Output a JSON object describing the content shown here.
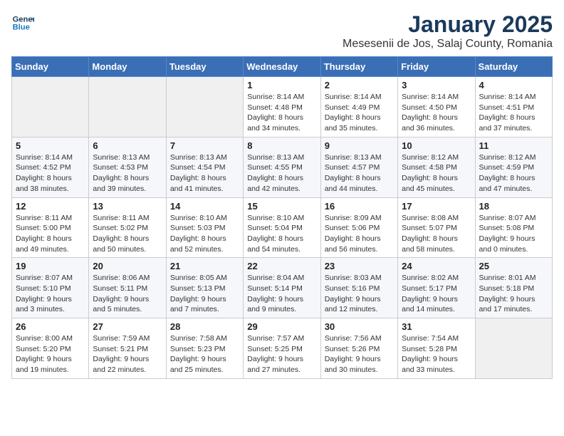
{
  "header": {
    "logo_line1": "General",
    "logo_line2": "Blue",
    "month": "January 2025",
    "location": "Mesesenii de Jos, Salaj County, Romania"
  },
  "weekdays": [
    "Sunday",
    "Monday",
    "Tuesday",
    "Wednesday",
    "Thursday",
    "Friday",
    "Saturday"
  ],
  "weeks": [
    [
      {
        "day": "",
        "info": ""
      },
      {
        "day": "",
        "info": ""
      },
      {
        "day": "",
        "info": ""
      },
      {
        "day": "1",
        "info": "Sunrise: 8:14 AM\nSunset: 4:48 PM\nDaylight: 8 hours\nand 34 minutes."
      },
      {
        "day": "2",
        "info": "Sunrise: 8:14 AM\nSunset: 4:49 PM\nDaylight: 8 hours\nand 35 minutes."
      },
      {
        "day": "3",
        "info": "Sunrise: 8:14 AM\nSunset: 4:50 PM\nDaylight: 8 hours\nand 36 minutes."
      },
      {
        "day": "4",
        "info": "Sunrise: 8:14 AM\nSunset: 4:51 PM\nDaylight: 8 hours\nand 37 minutes."
      }
    ],
    [
      {
        "day": "5",
        "info": "Sunrise: 8:14 AM\nSunset: 4:52 PM\nDaylight: 8 hours\nand 38 minutes."
      },
      {
        "day": "6",
        "info": "Sunrise: 8:13 AM\nSunset: 4:53 PM\nDaylight: 8 hours\nand 39 minutes."
      },
      {
        "day": "7",
        "info": "Sunrise: 8:13 AM\nSunset: 4:54 PM\nDaylight: 8 hours\nand 41 minutes."
      },
      {
        "day": "8",
        "info": "Sunrise: 8:13 AM\nSunset: 4:55 PM\nDaylight: 8 hours\nand 42 minutes."
      },
      {
        "day": "9",
        "info": "Sunrise: 8:13 AM\nSunset: 4:57 PM\nDaylight: 8 hours\nand 44 minutes."
      },
      {
        "day": "10",
        "info": "Sunrise: 8:12 AM\nSunset: 4:58 PM\nDaylight: 8 hours\nand 45 minutes."
      },
      {
        "day": "11",
        "info": "Sunrise: 8:12 AM\nSunset: 4:59 PM\nDaylight: 8 hours\nand 47 minutes."
      }
    ],
    [
      {
        "day": "12",
        "info": "Sunrise: 8:11 AM\nSunset: 5:00 PM\nDaylight: 8 hours\nand 49 minutes."
      },
      {
        "day": "13",
        "info": "Sunrise: 8:11 AM\nSunset: 5:02 PM\nDaylight: 8 hours\nand 50 minutes."
      },
      {
        "day": "14",
        "info": "Sunrise: 8:10 AM\nSunset: 5:03 PM\nDaylight: 8 hours\nand 52 minutes."
      },
      {
        "day": "15",
        "info": "Sunrise: 8:10 AM\nSunset: 5:04 PM\nDaylight: 8 hours\nand 54 minutes."
      },
      {
        "day": "16",
        "info": "Sunrise: 8:09 AM\nSunset: 5:06 PM\nDaylight: 8 hours\nand 56 minutes."
      },
      {
        "day": "17",
        "info": "Sunrise: 8:08 AM\nSunset: 5:07 PM\nDaylight: 8 hours\nand 58 minutes."
      },
      {
        "day": "18",
        "info": "Sunrise: 8:07 AM\nSunset: 5:08 PM\nDaylight: 9 hours\nand 0 minutes."
      }
    ],
    [
      {
        "day": "19",
        "info": "Sunrise: 8:07 AM\nSunset: 5:10 PM\nDaylight: 9 hours\nand 3 minutes."
      },
      {
        "day": "20",
        "info": "Sunrise: 8:06 AM\nSunset: 5:11 PM\nDaylight: 9 hours\nand 5 minutes."
      },
      {
        "day": "21",
        "info": "Sunrise: 8:05 AM\nSunset: 5:13 PM\nDaylight: 9 hours\nand 7 minutes."
      },
      {
        "day": "22",
        "info": "Sunrise: 8:04 AM\nSunset: 5:14 PM\nDaylight: 9 hours\nand 9 minutes."
      },
      {
        "day": "23",
        "info": "Sunrise: 8:03 AM\nSunset: 5:16 PM\nDaylight: 9 hours\nand 12 minutes."
      },
      {
        "day": "24",
        "info": "Sunrise: 8:02 AM\nSunset: 5:17 PM\nDaylight: 9 hours\nand 14 minutes."
      },
      {
        "day": "25",
        "info": "Sunrise: 8:01 AM\nSunset: 5:18 PM\nDaylight: 9 hours\nand 17 minutes."
      }
    ],
    [
      {
        "day": "26",
        "info": "Sunrise: 8:00 AM\nSunset: 5:20 PM\nDaylight: 9 hours\nand 19 minutes."
      },
      {
        "day": "27",
        "info": "Sunrise: 7:59 AM\nSunset: 5:21 PM\nDaylight: 9 hours\nand 22 minutes."
      },
      {
        "day": "28",
        "info": "Sunrise: 7:58 AM\nSunset: 5:23 PM\nDaylight: 9 hours\nand 25 minutes."
      },
      {
        "day": "29",
        "info": "Sunrise: 7:57 AM\nSunset: 5:25 PM\nDaylight: 9 hours\nand 27 minutes."
      },
      {
        "day": "30",
        "info": "Sunrise: 7:56 AM\nSunset: 5:26 PM\nDaylight: 9 hours\nand 30 minutes."
      },
      {
        "day": "31",
        "info": "Sunrise: 7:54 AM\nSunset: 5:28 PM\nDaylight: 9 hours\nand 33 minutes."
      },
      {
        "day": "",
        "info": ""
      }
    ]
  ]
}
